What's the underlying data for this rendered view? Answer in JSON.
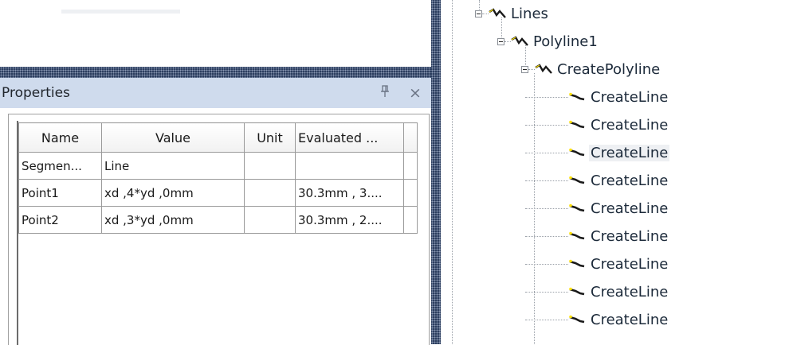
{
  "properties": {
    "title": "Properties",
    "pin_glyph": "q",
    "close_glyph": "×",
    "columns": [
      "Name",
      "Value",
      "Unit",
      "Evaluated ..."
    ],
    "rows": [
      {
        "name": "Segmen...",
        "value": "Line",
        "unit": "",
        "evaluated": ""
      },
      {
        "name": "Point1",
        "value": "xd ,4*yd ,0mm",
        "unit": "",
        "evaluated": "30.3mm , 3...."
      },
      {
        "name": "Point2",
        "value": "xd ,3*yd ,0mm",
        "unit": "",
        "evaluated": "30.3mm , 2...."
      }
    ]
  },
  "tree": {
    "nodes": [
      {
        "label": "Lines",
        "level": 0,
        "icon": "polyline-icon"
      },
      {
        "label": "Polyline1",
        "level": 1,
        "icon": "polyline-icon"
      },
      {
        "label": "CreatePolyline",
        "level": 2,
        "icon": "polyline-icon"
      },
      {
        "label": "CreateLine",
        "level": 3,
        "icon": "line-icon"
      },
      {
        "label": "CreateLine",
        "level": 3,
        "icon": "line-icon"
      },
      {
        "label": "CreateLine",
        "level": 3,
        "icon": "line-icon",
        "selected": true
      },
      {
        "label": "CreateLine",
        "level": 3,
        "icon": "line-icon"
      },
      {
        "label": "CreateLine",
        "level": 3,
        "icon": "line-icon"
      },
      {
        "label": "CreateLine",
        "level": 3,
        "icon": "line-icon"
      },
      {
        "label": "CreateLine",
        "level": 3,
        "icon": "line-icon"
      },
      {
        "label": "CreateLine",
        "level": 3,
        "icon": "line-icon"
      },
      {
        "label": "CreateLine",
        "level": 3,
        "icon": "line-icon"
      }
    ]
  },
  "colors": {
    "panel_title_bg": "#cfdbed",
    "splitter": "#2c3e5f",
    "icon_yellow": "#ffe100",
    "icon_dark": "#1a1a1a"
  }
}
